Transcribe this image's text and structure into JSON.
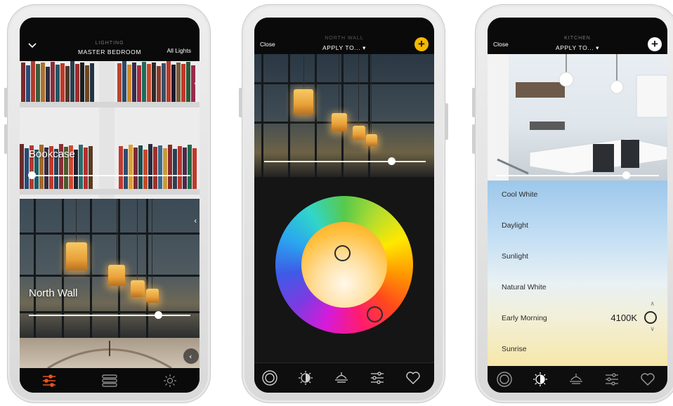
{
  "phone1": {
    "header": {
      "subtitle": "LIGHTING",
      "title": "MASTER BEDROOM",
      "action": "All Lights"
    },
    "scenes": [
      {
        "label": "Bookcase",
        "level": 0.02
      },
      {
        "label": "North Wall",
        "level": 0.8
      }
    ],
    "tabs": [
      {
        "icon": "sliders-icon",
        "active": true
      },
      {
        "icon": "stack-icon"
      },
      {
        "icon": "sun-icon"
      }
    ],
    "colors": {
      "active": "#e8541e"
    }
  },
  "phone2": {
    "header": {
      "close": "Close",
      "scene": "NORTH WALL",
      "apply": "APPLY TO... ▾"
    },
    "brightness": 0.79,
    "tabs": [
      {
        "icon": "target-icon"
      },
      {
        "icon": "color-temp-icon"
      },
      {
        "icon": "lamp-icon"
      },
      {
        "icon": "sliders-icon"
      },
      {
        "icon": "heart-icon"
      }
    ],
    "colors": {
      "accent": "#f5b800"
    }
  },
  "phone3": {
    "header": {
      "close": "Close",
      "scene": "KITCHEN",
      "apply": "APPLY TO... ▾"
    },
    "brightness": 0.8,
    "presets": [
      "Cool White",
      "Daylight",
      "Sunlight",
      "Natural White",
      "Early Morning",
      "Sunrise"
    ],
    "kelvin": "4100K",
    "tabs": [
      {
        "icon": "target-icon"
      },
      {
        "icon": "color-temp-icon",
        "active": true
      },
      {
        "icon": "lamp-icon"
      },
      {
        "icon": "sliders-icon"
      },
      {
        "icon": "heart-icon"
      }
    ]
  }
}
